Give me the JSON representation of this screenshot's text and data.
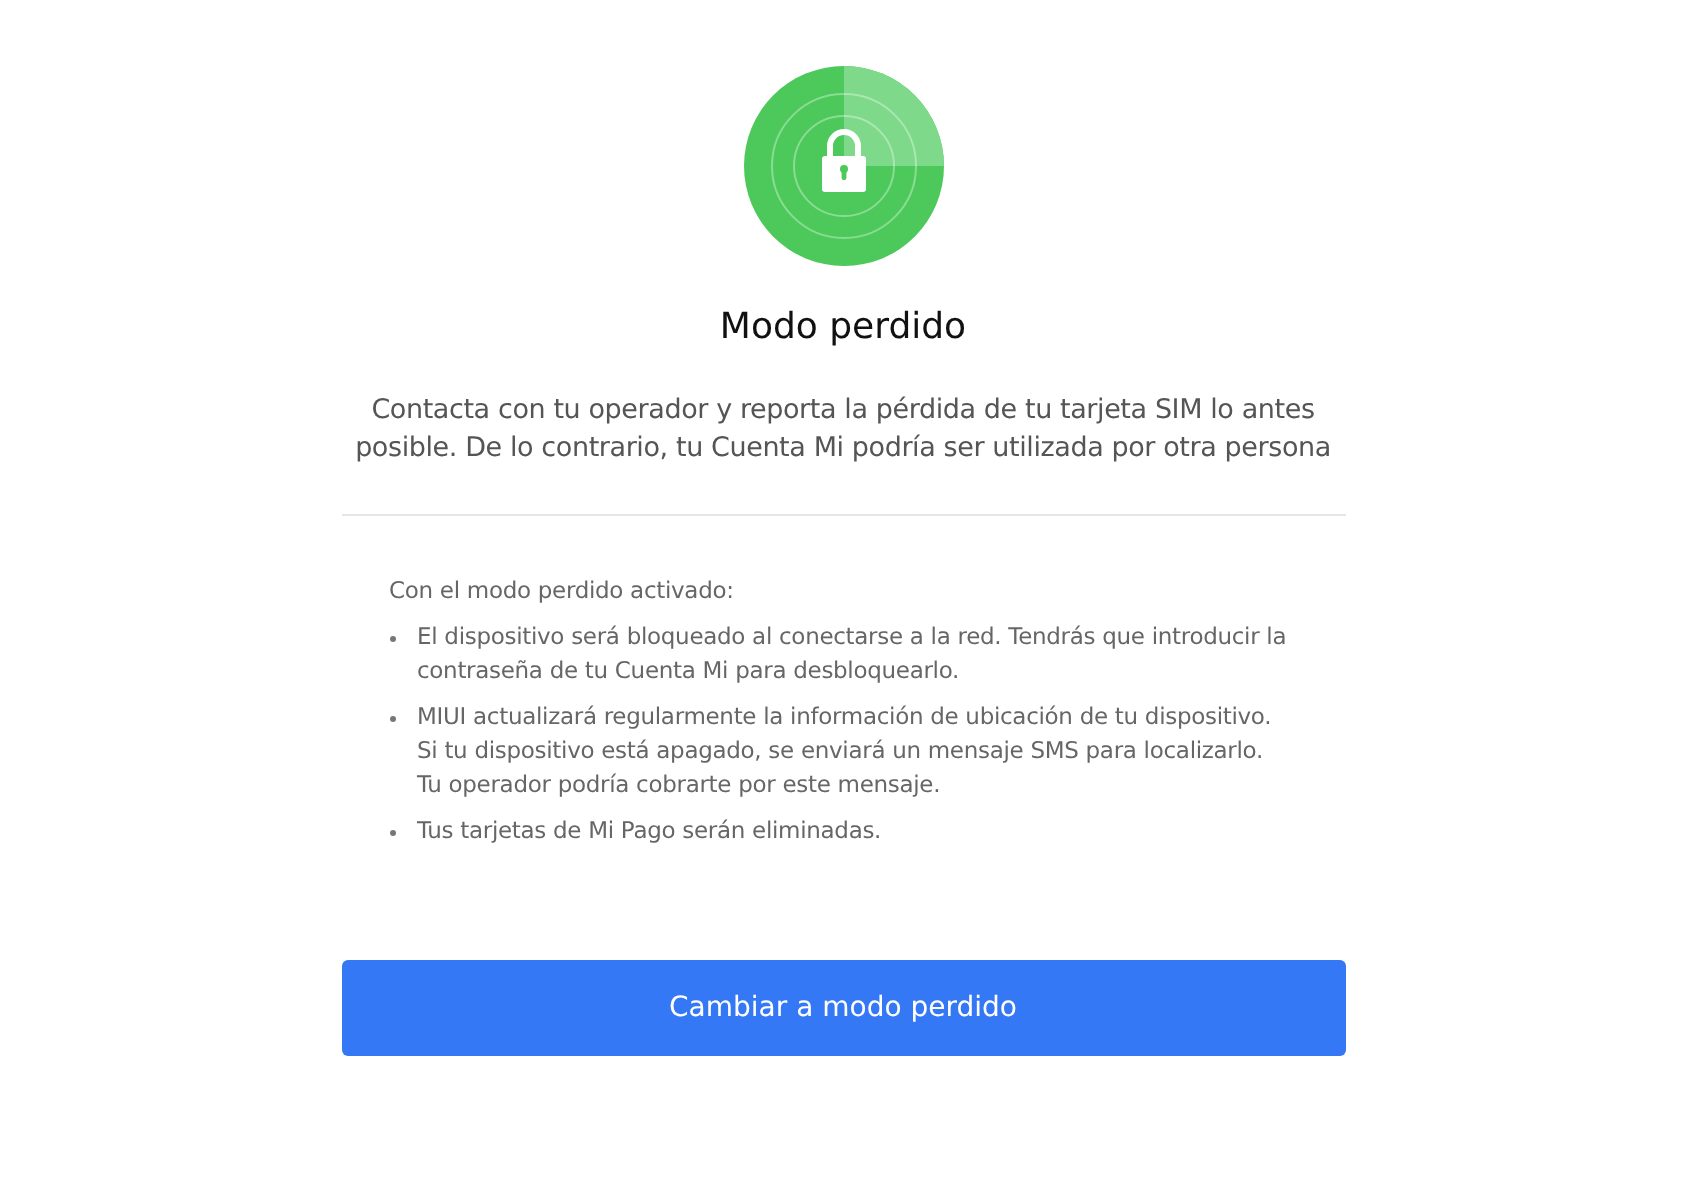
{
  "title": "Modo perdido",
  "description": "Contacta con tu operador y reporta la pérdida de tu tarjeta SIM lo antes posible. De lo contrario, tu Cuenta Mi podría ser utilizada por otra persona",
  "info_heading": "Con el modo perdido activado:",
  "info_items": [
    {
      "lines": [
        "El dispositivo será bloqueado al conectarse a la red. Tendrás que introducir la contraseña de tu Cuenta Mi para desbloquearlo."
      ]
    },
    {
      "lines": [
        "MIUI actualizará regularmente la información de ubicación de tu dispositivo.",
        "Si tu dispositivo está apagado, se enviará un mensaje SMS para localizarlo.",
        "Tu operador podría cobrarte por este mensaje."
      ]
    },
    {
      "lines": [
        "Tus tarjetas de Mi Pago serán eliminadas."
      ]
    }
  ],
  "button": "Cambiar a modo perdido"
}
